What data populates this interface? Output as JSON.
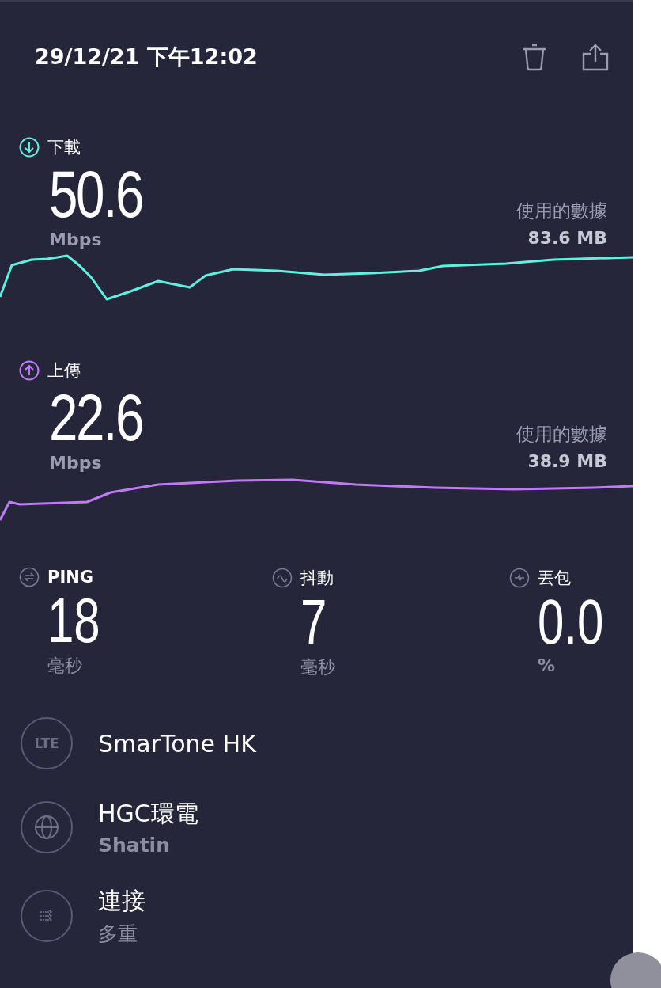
{
  "header": {
    "datetime": "29/12/21 下午12:02"
  },
  "speeds": [
    {
      "kind": "download",
      "label": "下載",
      "value": "50.6",
      "unit": "Mbps",
      "data_label": "使用的數據",
      "data_value": "83.6 MB",
      "color": "#5ef0e0"
    },
    {
      "kind": "upload",
      "label": "上傳",
      "value": "22.6",
      "unit": "Mbps",
      "data_label": "使用的數據",
      "data_value": "38.9 MB",
      "color": "#c07af5"
    }
  ],
  "metrics": [
    {
      "kind": "ping",
      "label": "PING",
      "value": "18",
      "unit": "毫秒"
    },
    {
      "kind": "jitter",
      "label": "抖動",
      "value": "7",
      "unit": "毫秒"
    },
    {
      "kind": "loss",
      "label": "丟包",
      "value": "0.0",
      "unit": "%"
    }
  ],
  "details": [
    {
      "kind": "lte",
      "badge": "LTE",
      "title": "SmarTone HK"
    },
    {
      "kind": "globe",
      "title": "HGC環電",
      "subtitle": "Shatin"
    },
    {
      "kind": "connections",
      "title": "連接",
      "subtitle": "多重"
    }
  ]
}
